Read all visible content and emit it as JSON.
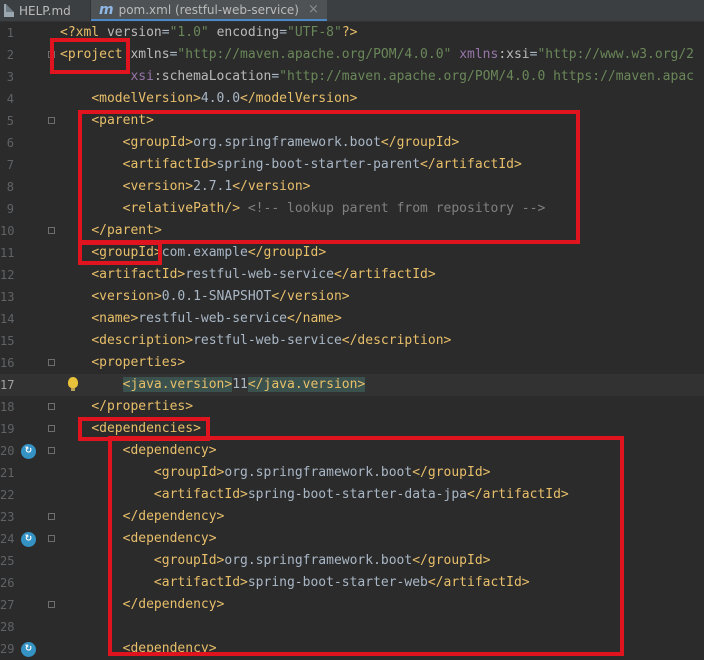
{
  "tabs": [
    {
      "label": "HELP.md",
      "icon": "markdown-file-icon",
      "active": false
    },
    {
      "label": "pom.xml (restful-web-service)",
      "icon": "maven-icon",
      "active": true
    }
  ],
  "maven_glyph": "m",
  "close_glyph": "×",
  "gutter_glyph": "↻",
  "colors": {
    "tag": "#e8bf6a",
    "string": "#6a8759",
    "comment": "#808080",
    "highlight_box": "#e0141e"
  },
  "lines": [
    {
      "n": "1",
      "text": "<?xml version=\"1.0\" encoding=\"UTF-8\"?>"
    },
    {
      "n": "2",
      "text": "<project xmlns=\"http://maven.apache.org/POM/4.0.0\" xmlns:xsi=\"http://www.w3.org/2"
    },
    {
      "n": "3",
      "text": "         xsi:schemaLocation=\"http://maven.apache.org/POM/4.0.0 https://maven.apac"
    },
    {
      "n": "4",
      "text": "    <modelVersion>4.0.0</modelVersion>"
    },
    {
      "n": "5",
      "text": "    <parent>"
    },
    {
      "n": "6",
      "text": "        <groupId>org.springframework.boot</groupId>"
    },
    {
      "n": "7",
      "text": "        <artifactId>spring-boot-starter-parent</artifactId>"
    },
    {
      "n": "8",
      "text": "        <version>2.7.1</version>"
    },
    {
      "n": "9",
      "text": "        <relativePath/> <!-- lookup parent from repository -->"
    },
    {
      "n": "10",
      "text": "    </parent>"
    },
    {
      "n": "11",
      "text": "    <groupId>com.example</groupId>"
    },
    {
      "n": "12",
      "text": "    <artifactId>restful-web-service</artifactId>"
    },
    {
      "n": "13",
      "text": "    <version>0.0.1-SNAPSHOT</version>"
    },
    {
      "n": "14",
      "text": "    <name>restful-web-service</name>"
    },
    {
      "n": "15",
      "text": "    <description>restful-web-service</description>"
    },
    {
      "n": "16",
      "text": "    <properties>"
    },
    {
      "n": "17",
      "text": "        <java.version>11</java.version>"
    },
    {
      "n": "18",
      "text": "    </properties>"
    },
    {
      "n": "19",
      "text": "    <dependencies>"
    },
    {
      "n": "20",
      "text": "        <dependency>"
    },
    {
      "n": "21",
      "text": "            <groupId>org.springframework.boot</groupId>"
    },
    {
      "n": "22",
      "text": "            <artifactId>spring-boot-starter-data-jpa</artifactId>"
    },
    {
      "n": "23",
      "text": "        </dependency>"
    },
    {
      "n": "24",
      "text": "        <dependency>"
    },
    {
      "n": "25",
      "text": "            <groupId>org.springframework.boot</groupId>"
    },
    {
      "n": "26",
      "text": "            <artifactId>spring-boot-starter-web</artifactId>"
    },
    {
      "n": "27",
      "text": "        </dependency>"
    },
    {
      "n": "28",
      "text": ""
    },
    {
      "n": "29",
      "text": "        <dependency>"
    }
  ]
}
